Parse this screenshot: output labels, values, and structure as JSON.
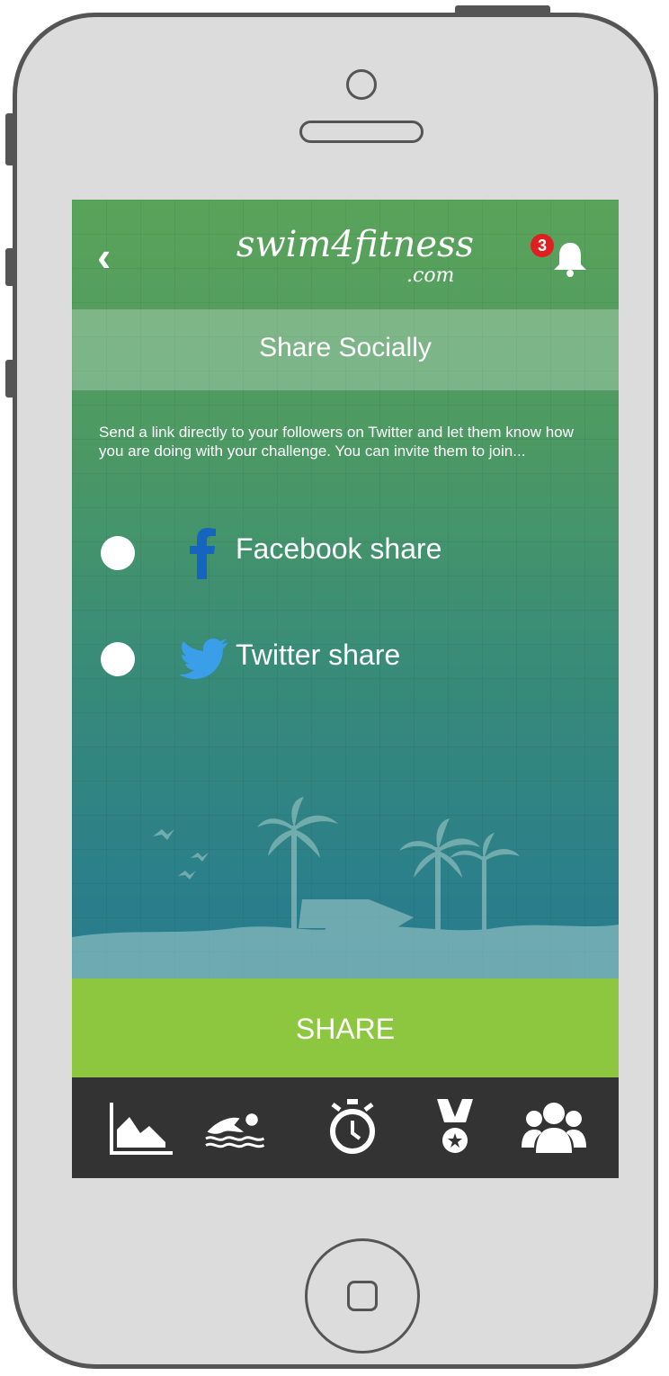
{
  "app": {
    "logo_text": "swim4fitness",
    "logo_suffix": ".com",
    "notification_count": "3"
  },
  "page": {
    "title": "Share Socially",
    "description": "Send a link directly to your followers on Twitter and let them know how you are doing with your challenge. You can invite them to join..."
  },
  "options": [
    {
      "label": "Facebook share",
      "icon": "facebook-icon",
      "selected": false
    },
    {
      "label": "Twitter share",
      "icon": "twitter-icon",
      "selected": false
    }
  ],
  "share_button": {
    "label": "SHARE"
  },
  "tabs": [
    {
      "icon": "stats-chart-icon"
    },
    {
      "icon": "swimmer-icon"
    },
    {
      "icon": "stopwatch-icon"
    },
    {
      "icon": "medal-icon"
    },
    {
      "icon": "group-icon"
    }
  ],
  "colors": {
    "header_green": "#5aa35a",
    "bottom_blue": "#1f7498",
    "share_green": "#8dc63f",
    "tabbar": "#333333",
    "facebook_blue": "#1565c0",
    "twitter_blue": "#3a9ee8",
    "badge_red": "#e02020"
  }
}
